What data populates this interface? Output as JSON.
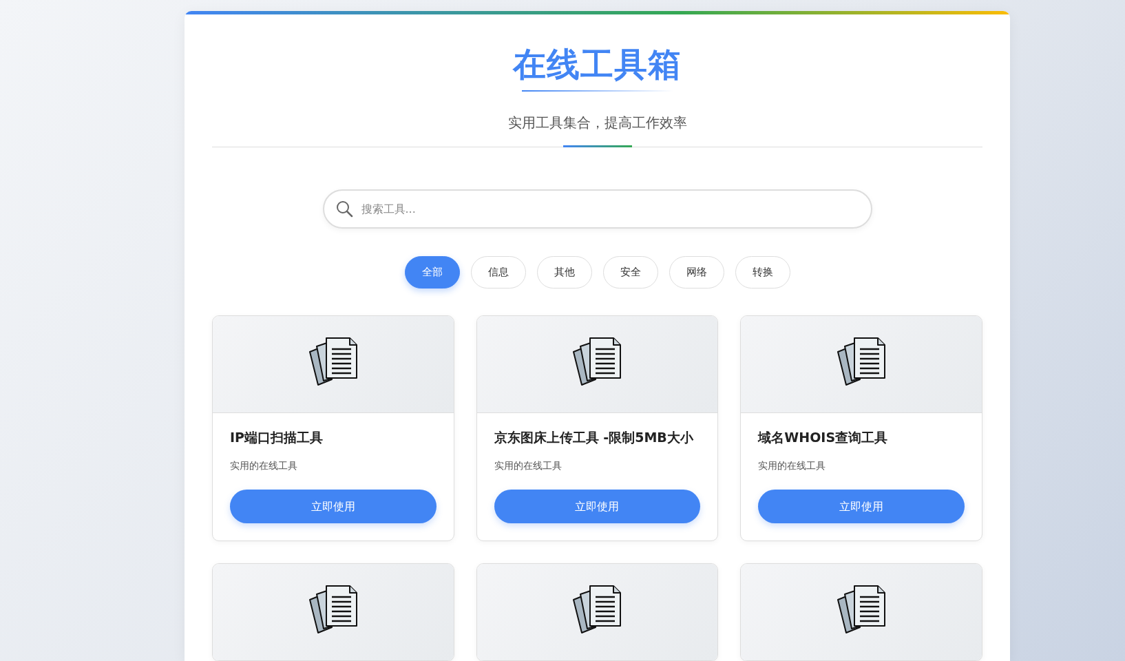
{
  "header": {
    "title": "在线工具箱",
    "subtitle": "实用工具集合，提高工作效率"
  },
  "search": {
    "placeholder": "搜索工具..."
  },
  "filters": [
    {
      "label": "全部",
      "selected": true
    },
    {
      "label": "信息",
      "selected": false
    },
    {
      "label": "其他",
      "selected": false
    },
    {
      "label": "安全",
      "selected": false
    },
    {
      "label": "网络",
      "selected": false
    },
    {
      "label": "转换",
      "selected": false
    }
  ],
  "cards": [
    {
      "kind": "full",
      "title": "IP端口扫描工具",
      "description": "实用的在线工具",
      "button": "立即使用"
    },
    {
      "kind": "full",
      "title": "京东图床上传工具 -限制5MB大小",
      "description": "实用的在线工具",
      "button": "立即使用"
    },
    {
      "kind": "full",
      "title": "域名WHOIS查询工具",
      "description": "实用的在线工具",
      "button": "立即使用"
    },
    {
      "kind": "image_only"
    },
    {
      "kind": "image_only"
    },
    {
      "kind": "image_only"
    }
  ]
}
